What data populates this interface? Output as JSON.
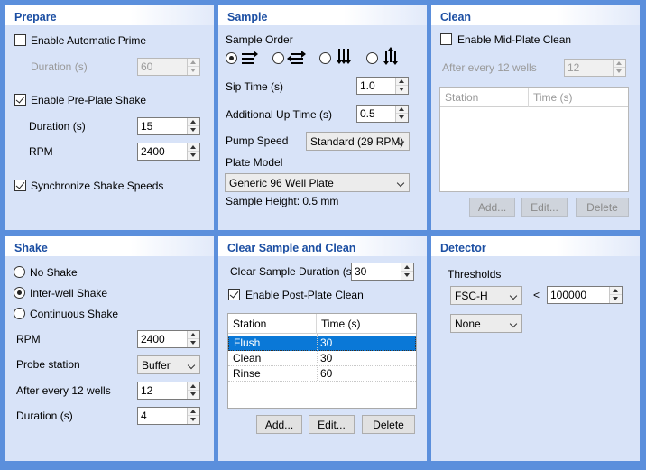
{
  "prepare": {
    "title": "Prepare",
    "auto_prime_label": "Enable Automatic Prime",
    "auto_prime_checked": false,
    "prime_duration_label": "Duration (s)",
    "prime_duration_value": "60",
    "pre_shake_label": "Enable Pre-Plate Shake",
    "pre_shake_checked": true,
    "shake_duration_label": "Duration (s)",
    "shake_duration_value": "15",
    "rpm_label": "RPM",
    "rpm_value": "2400",
    "sync_label": "Synchronize Shake Speeds",
    "sync_checked": true
  },
  "sample": {
    "title": "Sample",
    "order_label": "Sample Order",
    "order_selected_index": 0,
    "order_icons": [
      "rows-right-order-icon",
      "rows-serpentine-order-icon",
      "columns-down-order-icon",
      "columns-serpentine-order-icon"
    ],
    "sip_label": "Sip Time (s)",
    "sip_value": "1.0",
    "up_label": "Additional Up Time (s)",
    "up_value": "0.5",
    "pump_label": "Pump Speed",
    "pump_value": "Standard (29 RPM)",
    "plate_label": "Plate Model",
    "plate_value": "Generic 96 Well Plate",
    "height_text": "Sample Height: 0.5 mm"
  },
  "clean": {
    "title": "Clean",
    "mid_label": "Enable Mid-Plate Clean",
    "mid_checked": false,
    "after_label": "After every 12 wells",
    "after_value": "12",
    "col_station": "Station",
    "col_time": "Time (s)",
    "add": "Add...",
    "edit": "Edit...",
    "delete": "Delete"
  },
  "shake": {
    "title": "Shake",
    "no_shake": "No Shake",
    "inter_well": "Inter-well Shake",
    "continuous": "Continuous Shake",
    "selected_index": 1,
    "rpm_label": "RPM",
    "rpm_value": "2400",
    "probe_label": "Probe station",
    "probe_value": "Buffer",
    "after_label": "After every 12 wells",
    "after_value": "12",
    "duration_label": "Duration (s)",
    "duration_value": "4"
  },
  "clear": {
    "title": "Clear Sample and Clean",
    "duration_label": "Clear Sample Duration (s)",
    "duration_value": "30",
    "post_label": "Enable Post-Plate Clean",
    "post_checked": true,
    "col_station": "Station",
    "col_time": "Time (s)",
    "rows": [
      {
        "station": "Flush",
        "time": "30",
        "selected": true
      },
      {
        "station": "Clean",
        "time": "30",
        "selected": false
      },
      {
        "station": "Rinse",
        "time": "60",
        "selected": false
      }
    ],
    "add": "Add...",
    "edit": "Edit...",
    "delete": "Delete"
  },
  "detector": {
    "title": "Detector",
    "thresholds_label": "Thresholds",
    "channel_value": "FSC-H",
    "operator": "<",
    "threshold_value": "100000",
    "second_value": "None"
  },
  "colors": {
    "background": "#5b8fdc",
    "panel": "#d8e3f8",
    "title_text": "#1c4fa3",
    "selection": "#0a78d7"
  }
}
